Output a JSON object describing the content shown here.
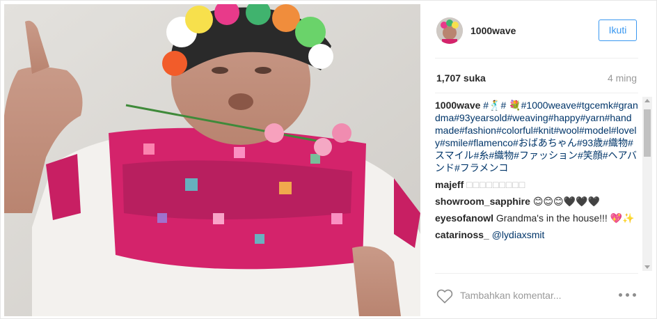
{
  "post": {
    "username": "1000wave",
    "follow_label": "Ikuti",
    "likes": "1,707 suka",
    "age": "4 ming"
  },
  "caption": {
    "username": "1000wave",
    "text_part1": "#🕺#",
    "text_part2": "💐#1000weave#tgcemk#grandma#93yearsold#weaving#happy#yarn#handmade#fashion#colorful#knit#wool#model#lovely#smile#flamenco#おばあちゃん#93歳#織物#スマイル#糸#織物#ファッション#笑顔#ヘアバンド#フラメンコ"
  },
  "comments": [
    {
      "username": "majeff",
      "text": "□□□□□□□□□"
    },
    {
      "username": "showroom_sapphire",
      "text": "😊😊😊🖤🖤🖤"
    },
    {
      "username": "eyesofanowl",
      "text": "Grandma's in the house!!! 💖✨"
    },
    {
      "username": "catarinoss_",
      "text": "@lydiaxsmit"
    }
  ],
  "footer": {
    "comment_placeholder": "Tambahkan komentar..."
  },
  "icons": {
    "like": "heart-icon",
    "more": "more-options-icon"
  },
  "colors": {
    "follow_blue": "#3897f0",
    "hashtag": "#003569",
    "muted": "#999999"
  }
}
